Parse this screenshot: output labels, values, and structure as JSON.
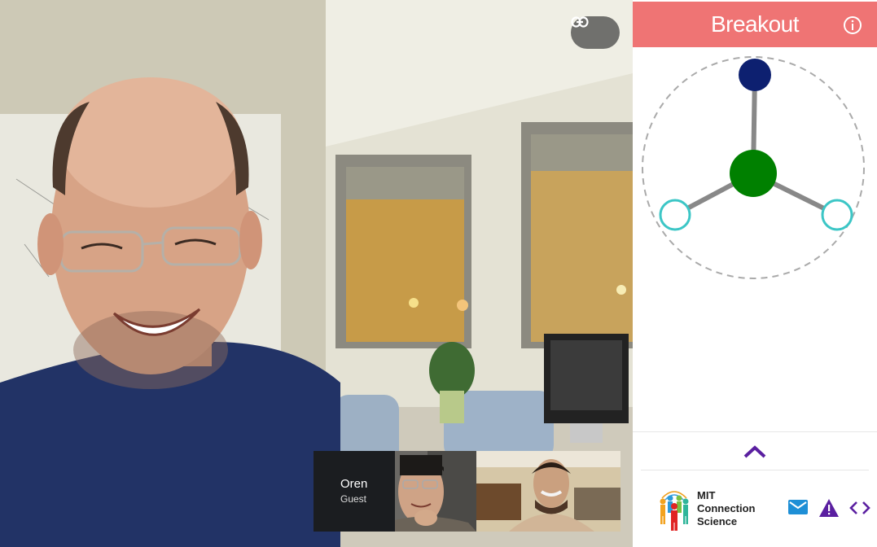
{
  "main_video": {
    "link_icon": "link-icon"
  },
  "filmstrip": {
    "guest": {
      "name": "Oren",
      "role": "Guest"
    }
  },
  "panel": {
    "title": "Breakout",
    "info_icon": "info-circle-icon",
    "network": {
      "center_color": "#008000",
      "top_node_color": "#0d2070",
      "empty_node_color": "#3cc6c6",
      "link_color": "#888888",
      "ring_color": "#aaaaaa"
    },
    "expand_icon": "chevron-up-icon",
    "footer": {
      "org_line1": "MIT",
      "org_line2": "Connection",
      "org_line3": "Science",
      "mail_icon": "mail-icon",
      "warning_icon": "warning-icon",
      "code_icon": "code-icon"
    }
  },
  "colors": {
    "header": "#ef7474",
    "accent": "#5a1fa0",
    "mail": "#1e8fd6"
  }
}
